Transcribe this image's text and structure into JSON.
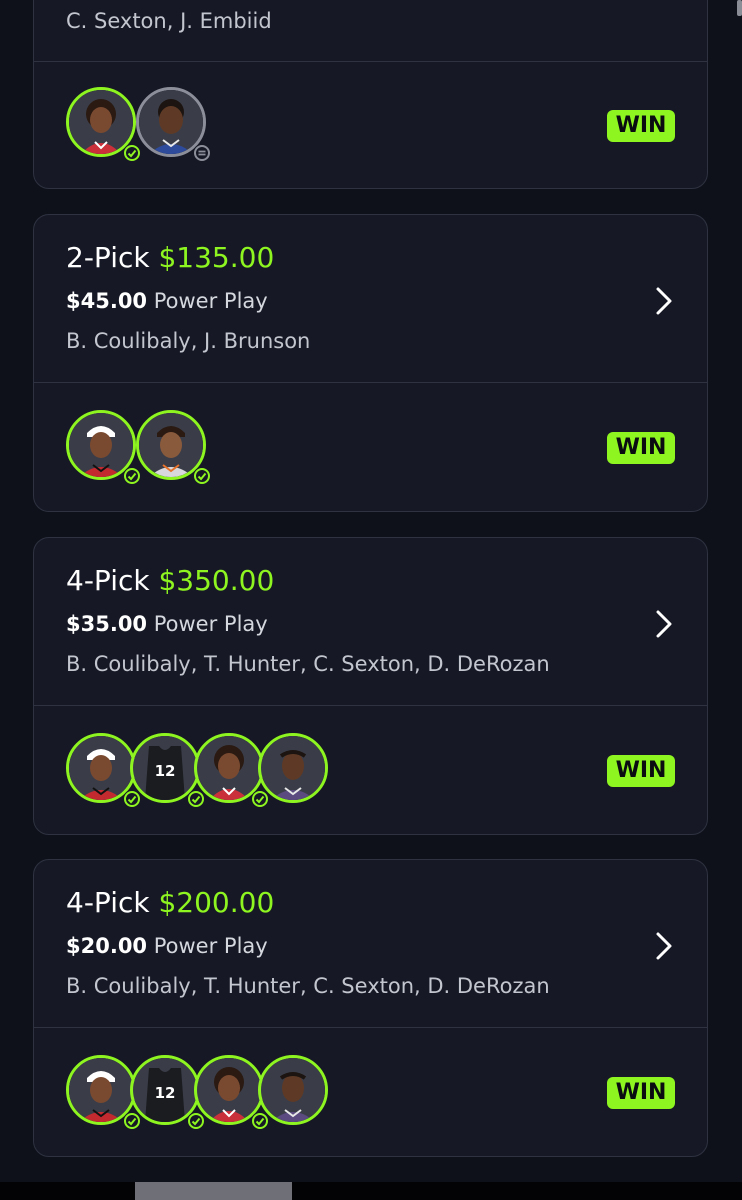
{
  "colors": {
    "accent": "#8ef520",
    "background": "#0f111a",
    "card": "#161925",
    "border": "#2e3241",
    "push": "#8c8f99"
  },
  "cards": [
    {
      "title": "",
      "payout": "",
      "stake_amount": "",
      "stake_label": "",
      "players": "C. Sexton, J. Embiid",
      "result": "WIN",
      "avatars": [
        {
          "name": "C. Sexton",
          "status": "win",
          "status_icon": "check-icon"
        },
        {
          "name": "J. Embiid",
          "status": "push",
          "status_icon": "equals-icon"
        }
      ]
    },
    {
      "title": "2-Pick",
      "payout": "$135.00",
      "stake_amount": "$45.00",
      "stake_label": "Power Play",
      "players": "B. Coulibaly, J. Brunson",
      "result": "WIN",
      "avatars": [
        {
          "name": "B. Coulibaly",
          "status": "win",
          "status_icon": "check-icon"
        },
        {
          "name": "J. Brunson",
          "status": "win",
          "status_icon": "check-icon"
        }
      ]
    },
    {
      "title": "4-Pick",
      "payout": "$350.00",
      "stake_amount": "$35.00",
      "stake_label": "Power Play",
      "players": "B. Coulibaly, T. Hunter, C. Sexton, D. DeRozan",
      "result": "WIN",
      "avatars": [
        {
          "name": "B. Coulibaly",
          "status": "win",
          "status_icon": "check-icon"
        },
        {
          "name": "T. Hunter",
          "status": "win",
          "status_icon": "check-icon",
          "jersey_number": "12"
        },
        {
          "name": "C. Sexton",
          "status": "win",
          "status_icon": "check-icon"
        },
        {
          "name": "D. DeRozan",
          "status": "win",
          "status_icon": ""
        }
      ]
    },
    {
      "title": "4-Pick",
      "payout": "$200.00",
      "stake_amount": "$20.00",
      "stake_label": "Power Play",
      "players": "B. Coulibaly, T. Hunter, C. Sexton, D. DeRozan",
      "result": "WIN",
      "avatars": [
        {
          "name": "B. Coulibaly",
          "status": "win",
          "status_icon": "check-icon"
        },
        {
          "name": "T. Hunter",
          "status": "win",
          "status_icon": "check-icon",
          "jersey_number": "12"
        },
        {
          "name": "C. Sexton",
          "status": "win",
          "status_icon": "check-icon"
        },
        {
          "name": "D. DeRozan",
          "status": "win",
          "status_icon": ""
        }
      ]
    }
  ]
}
